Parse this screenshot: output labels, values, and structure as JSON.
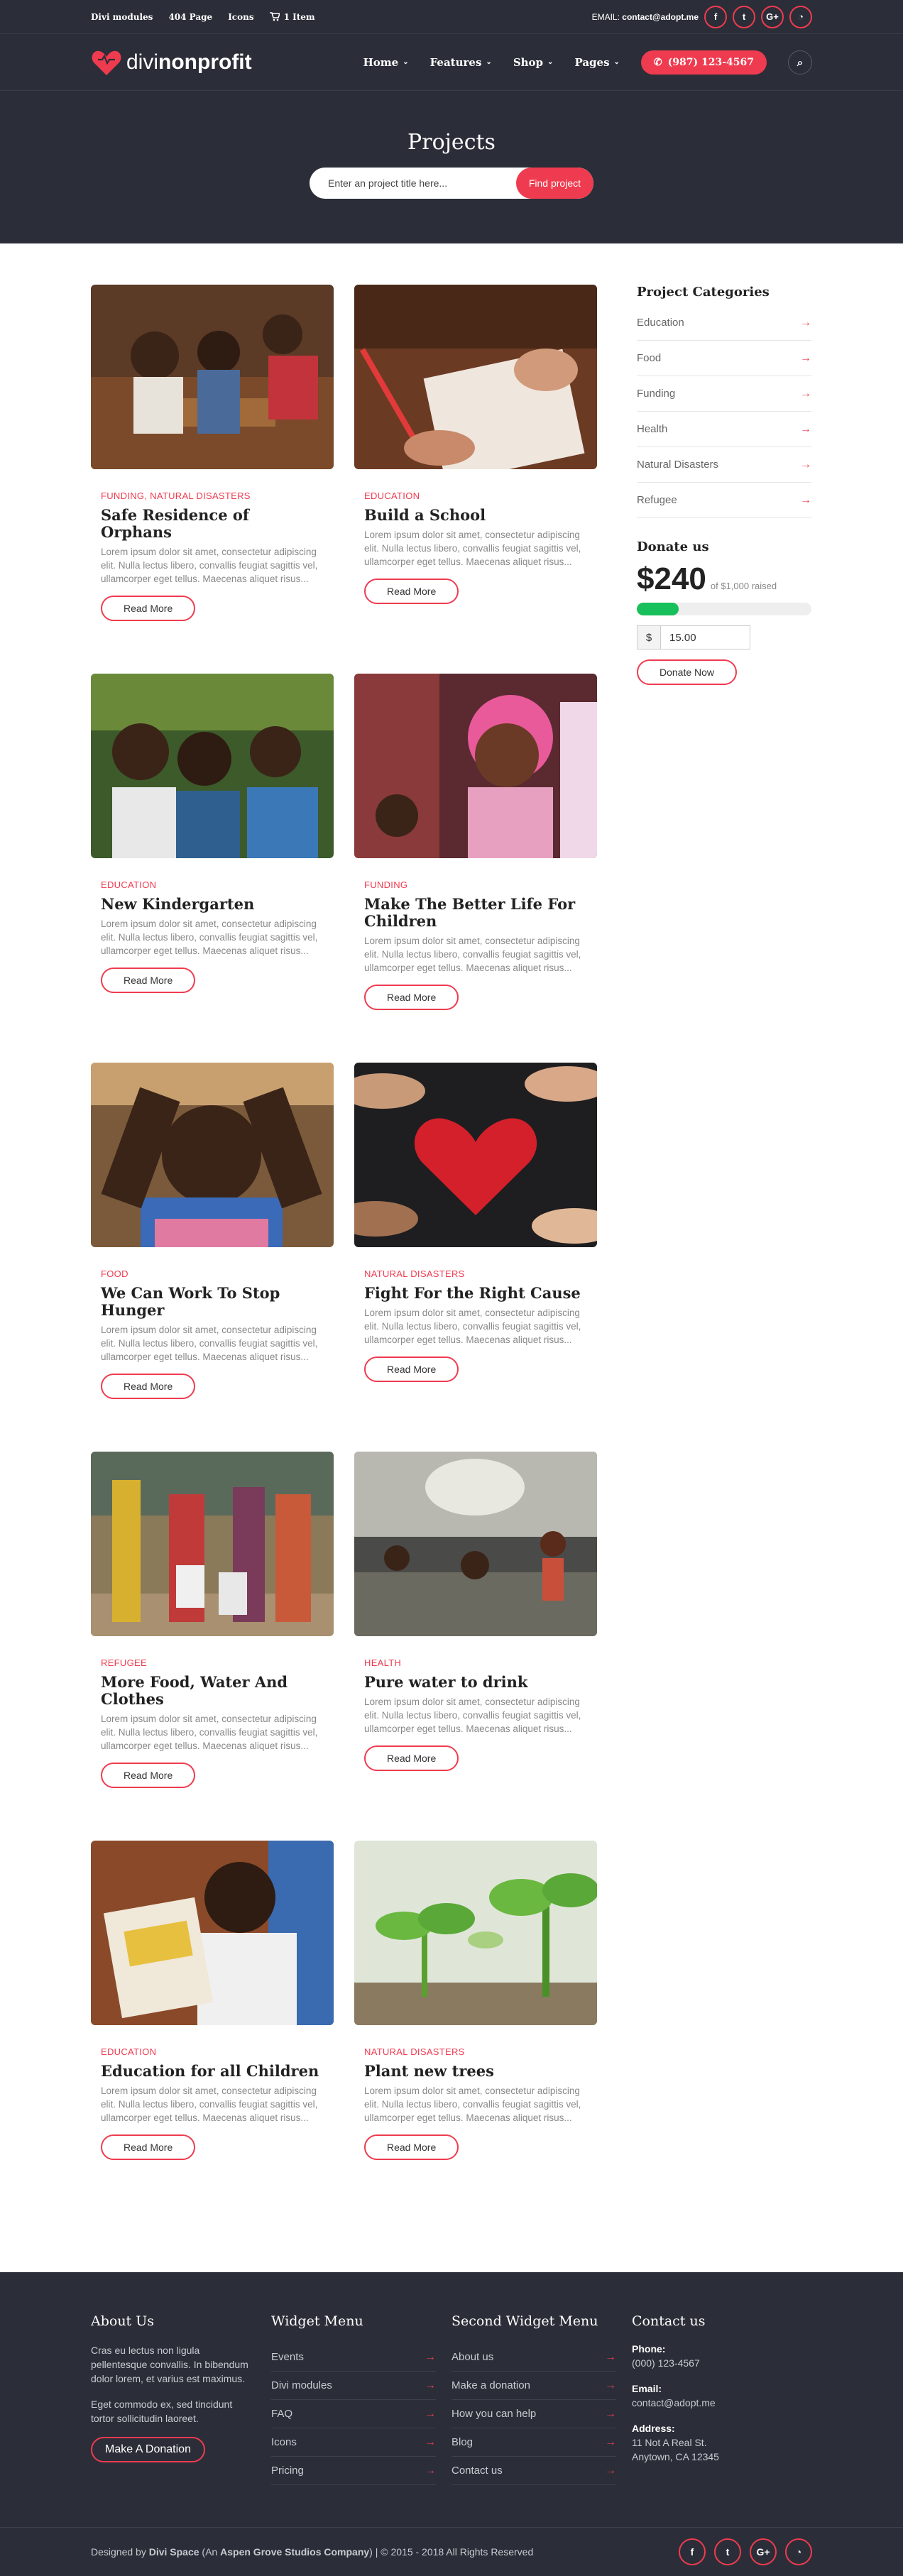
{
  "topbar": {
    "links": [
      "Divi modules",
      "404 Page",
      "Icons"
    ],
    "cart_label": "1 Item",
    "email_label": "EMAIL:",
    "email_value": "contact@adopt.me",
    "socials": [
      "facebook-icon",
      "twitter-icon",
      "google-plus-icon",
      "rss-icon"
    ]
  },
  "header": {
    "logo_light": "divi",
    "logo_bold": "nonprofit",
    "nav": [
      "Home",
      "Features",
      "Shop",
      "Pages"
    ],
    "phone": "(987) 123-4567"
  },
  "hero": {
    "title": "Projects",
    "search_placeholder": "Enter an project title here...",
    "search_button": "Find project"
  },
  "projects": [
    {
      "category": "FUNDING, NATURAL DISASTERS",
      "title": "Safe Residence of Orphans",
      "excerpt": "Lorem ipsum dolor sit amet, consectetur adipiscing elit. Nulla lectus libero, convallis feugiat sagittis vel, ullamcorper eget tellus. Maecenas aliquet risus...",
      "button": "Read More"
    },
    {
      "category": "EDUCATION",
      "title": "Build a School",
      "excerpt": "Lorem ipsum dolor sit amet, consectetur adipiscing elit. Nulla lectus libero, convallis feugiat sagittis vel, ullamcorper eget tellus. Maecenas aliquet risus...",
      "button": "Read More"
    },
    {
      "category": "EDUCATION",
      "title": "New Kindergarten",
      "excerpt": "Lorem ipsum dolor sit amet, consectetur adipiscing elit. Nulla lectus libero, convallis feugiat sagittis vel, ullamcorper eget tellus. Maecenas aliquet risus...",
      "button": "Read More"
    },
    {
      "category": "FUNDING",
      "title": "Make The Better Life For Children",
      "excerpt": "Lorem ipsum dolor sit amet, consectetur adipiscing elit. Nulla lectus libero, convallis feugiat sagittis vel, ullamcorper eget tellus. Maecenas aliquet risus...",
      "button": "Read More"
    },
    {
      "category": "FOOD",
      "title": "We Can Work To Stop Hunger",
      "excerpt": "Lorem ipsum dolor sit amet, consectetur adipiscing elit. Nulla lectus libero, convallis feugiat sagittis vel, ullamcorper eget tellus. Maecenas aliquet risus...",
      "button": "Read More"
    },
    {
      "category": "NATURAL DISASTERS",
      "title": "Fight For the Right Cause",
      "excerpt": "Lorem ipsum dolor sit amet, consectetur adipiscing elit. Nulla lectus libero, convallis feugiat sagittis vel, ullamcorper eget tellus. Maecenas aliquet risus...",
      "button": "Read More"
    },
    {
      "category": "REFUGEE",
      "title": "More Food, Water And Clothes",
      "excerpt": "Lorem ipsum dolor sit amet, consectetur adipiscing elit. Nulla lectus libero, convallis feugiat sagittis vel, ullamcorper eget tellus. Maecenas aliquet risus...",
      "button": "Read More"
    },
    {
      "category": "HEALTH",
      "title": "Pure water to drink",
      "excerpt": "Lorem ipsum dolor sit amet, consectetur adipiscing elit. Nulla lectus libero, convallis feugiat sagittis vel, ullamcorper eget tellus. Maecenas aliquet risus...",
      "button": "Read More"
    },
    {
      "category": "EDUCATION",
      "title": "Education for all Children",
      "excerpt": "Lorem ipsum dolor sit amet, consectetur adipiscing elit. Nulla lectus libero, convallis feugiat sagittis vel, ullamcorper eget tellus. Maecenas aliquet risus...",
      "button": "Read More"
    },
    {
      "category": "NATURAL DISASTERS",
      "title": "Plant new trees",
      "excerpt": "Lorem ipsum dolor sit amet, consectetur adipiscing elit. Nulla lectus libero, convallis feugiat sagittis vel, ullamcorper eget tellus. Maecenas aliquet risus...",
      "button": "Read More"
    }
  ],
  "sidebar": {
    "categories_title": "Project Categories",
    "categories": [
      "Education",
      "Food",
      "Funding",
      "Health",
      "Natural Disasters",
      "Refugee"
    ],
    "donate_title": "Donate us",
    "raised": "$240",
    "goal_text": "of $1,000 raised",
    "progress_fraction": 0.24,
    "currency": "$",
    "amount_value": "15.00",
    "donate_button": "Donate Now"
  },
  "footer": {
    "about": {
      "title": "About Us",
      "p1": "Cras eu lectus non ligula pellentesque convallis. In bibendum dolor lorem, et varius est maximus.",
      "p2": "Eget commodo ex, sed tincidunt tortor sollicitudin laoreet.",
      "button": "Make A Donation"
    },
    "widget1": {
      "title": "Widget Menu",
      "items": [
        "Events",
        "Divi modules",
        "FAQ",
        "Icons",
        "Pricing"
      ]
    },
    "widget2": {
      "title": "Second Widget Menu",
      "items": [
        "About us",
        "Make a donation",
        "How you can help",
        "Blog",
        "Contact us"
      ]
    },
    "contact": {
      "title": "Contact us",
      "phone_label": "Phone:",
      "phone": "(000) 123-4567",
      "email_label": "Email:",
      "email": "contact@adopt.me",
      "address_label": "Address:",
      "address1": "11 Not A Real St.",
      "address2": "Anytown, CA 12345"
    },
    "copyright_pre": "Designed by ",
    "copyright_brand": "Divi Space",
    "copyright_mid": " (An ",
    "copyright_company": "Aspen Grove Studios Company",
    "copyright_post": ") | © 2015 - 2018 All Rights Reserved"
  },
  "colors": {
    "accent": "#ef3b4f",
    "dark": "#2b2e38",
    "progress": "#17c05b"
  }
}
